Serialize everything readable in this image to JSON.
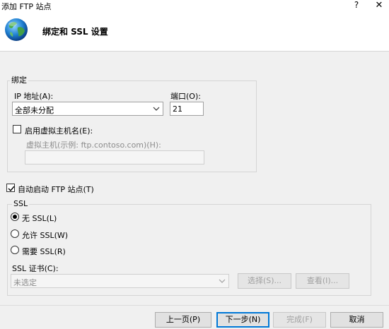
{
  "window": {
    "title": "添加 FTP 站点",
    "help_glyph": "?",
    "close_glyph": "✕"
  },
  "header": {
    "title": "绑定和 SSL 设置"
  },
  "binding": {
    "group_label": "绑定",
    "ip_label": "IP 地址(A):",
    "ip_value": "全部未分配",
    "port_label": "端口(O):",
    "port_value": "21",
    "virtual_host_checkbox_label": "启用虚拟主机名(E):",
    "virtual_host_checked": false,
    "virtual_host_field_label": "虚拟主机(示例: ftp.contoso.com)(H):",
    "virtual_host_value": ""
  },
  "autostart": {
    "label": "自动启动 FTP 站点(T)",
    "checked": true
  },
  "ssl": {
    "group_label": "SSL",
    "options": [
      {
        "label": "无 SSL(L)",
        "selected": true
      },
      {
        "label": "允许 SSL(W)",
        "selected": false
      },
      {
        "label": "需要 SSL(R)",
        "selected": false
      }
    ],
    "cert_label": "SSL 证书(C):",
    "cert_value": "未选定",
    "select_button": "选择(S)...",
    "view_button": "查看(I)..."
  },
  "footer": {
    "prev_button": "上一页(P)",
    "next_button": "下一步(N)",
    "finish_button": "完成(F)",
    "cancel_button": "取消"
  },
  "colors": {
    "focus_border": "#0078d7",
    "disabled_text": "#8c8c8c"
  }
}
